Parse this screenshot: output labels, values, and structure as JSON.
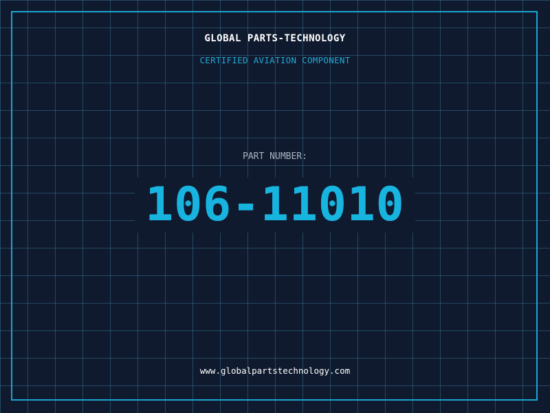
{
  "label": {
    "company": "GLOBAL PARTS-TECHNOLOGY",
    "tagline": "CERTIFIED AVIATION COMPONENT",
    "part_label": "PART NUMBER:",
    "part_number": "106-11010",
    "website": "www.globalpartstechnology.com"
  },
  "colors": {
    "background": "#101a2e",
    "grid": "#3882a0",
    "frame": "#1aa6d0",
    "accent": "#18b4e0",
    "text_primary": "#ffffff",
    "text_muted": "#a9b4c2"
  }
}
